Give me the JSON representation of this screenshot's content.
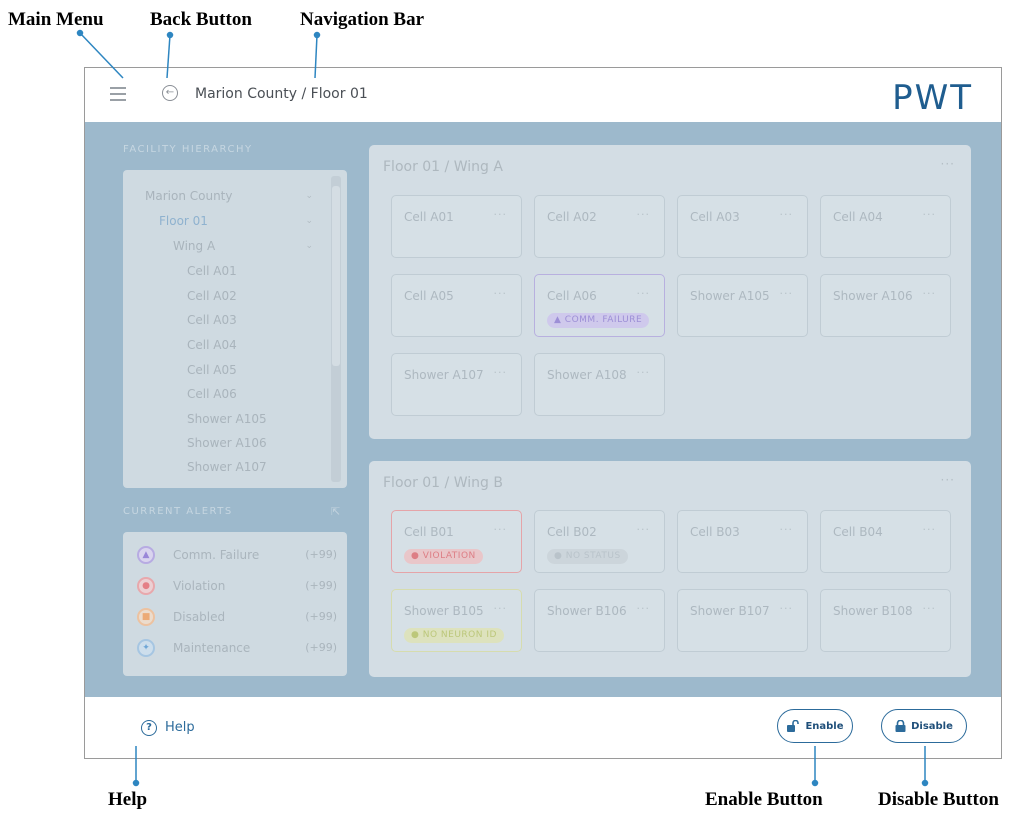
{
  "callouts": {
    "main_menu": "Main Menu",
    "back_button": "Back Button",
    "navigation_bar": "Navigation Bar",
    "help": "Help",
    "enable_button": "Enable Button",
    "disable_button": "Disable Button"
  },
  "header": {
    "breadcrumb": "Marion County / Floor 01",
    "logo": "PWT"
  },
  "sidebar": {
    "hierarchy_title": "FACILITY HIERARCHY",
    "tree": [
      "Marion County",
      "Floor 01",
      "Wing A",
      "Cell A01",
      "Cell A02",
      "Cell A03",
      "Cell A04",
      "Cell A05",
      "Cell A06",
      "Shower A105",
      "Shower A106",
      "Shower A107"
    ],
    "alerts_title": "CURRENT ALERTS",
    "alerts": [
      {
        "label": "Comm. Failure",
        "count": "(+99)",
        "color": "#9a86d8"
      },
      {
        "label": "Violation",
        "count": "(+99)",
        "color": "#e47f86"
      },
      {
        "label": "Disabled",
        "count": "(+99)",
        "color": "#ecaa76"
      },
      {
        "label": "Maintenance",
        "count": "(+99)",
        "color": "#6fa6d6"
      }
    ]
  },
  "wings": [
    {
      "title": "Floor 01 / Wing A",
      "more": "···",
      "cells": [
        {
          "name": "Cell A01"
        },
        {
          "name": "Cell A02"
        },
        {
          "name": "Cell A03"
        },
        {
          "name": "Cell A04"
        },
        {
          "name": "Cell A05"
        },
        {
          "name": "Cell A06",
          "badge": "COMM. FAILURE"
        },
        {
          "name": "Shower A105"
        },
        {
          "name": "Shower A106"
        },
        {
          "name": "Shower A107"
        },
        {
          "name": "Shower A108"
        }
      ]
    },
    {
      "title": "Floor 01 / Wing B",
      "more": "···",
      "cells": [
        {
          "name": "Cell B01",
          "badge": "VIOLATION"
        },
        {
          "name": "Cell B02",
          "badge": "NO STATUS"
        },
        {
          "name": "Cell B03"
        },
        {
          "name": "Cell B04"
        },
        {
          "name": "Shower B105",
          "badge": "NO NEURON ID"
        },
        {
          "name": "Shower B106"
        },
        {
          "name": "Shower B107"
        },
        {
          "name": "Shower B108"
        }
      ]
    }
  ],
  "footer": {
    "help_label": "Help",
    "enable_label": "Enable",
    "disable_label": "Disable"
  },
  "colors": {
    "accent": "#2c6b9b",
    "overlay": "#9db9cc",
    "comm_failure": "#9a86d8",
    "violation": "#e47f86",
    "no_status": "#b9c3ca",
    "no_neuron_id": "#c7d28a"
  }
}
